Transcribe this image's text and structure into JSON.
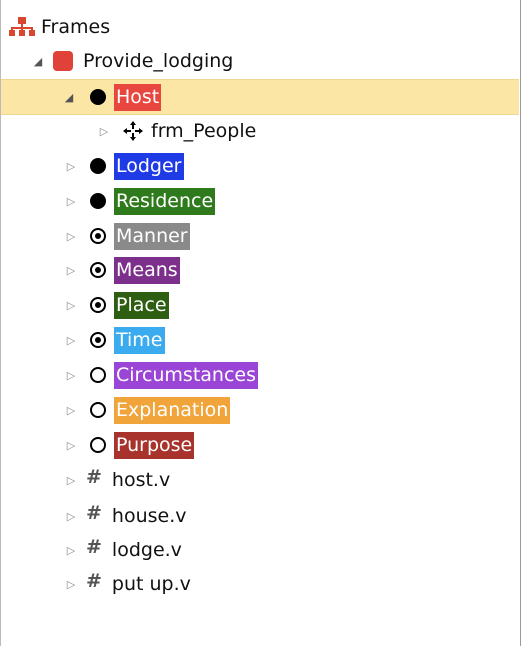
{
  "tree": {
    "root": {
      "label": "Frames",
      "icon": "hierarchy-icon"
    },
    "frame": {
      "label": "Provide_lodging",
      "icon": "frame-square-icon",
      "color": "#e0423a"
    },
    "elements": [
      {
        "label": "Host",
        "type": "core",
        "bg": "#e8473f",
        "fg": "#ffffff"
      },
      {
        "label": "Lodger",
        "type": "core",
        "bg": "#1f3be6",
        "fg": "#ffffff"
      },
      {
        "label": "Residence",
        "type": "core",
        "bg": "#2e7a1c",
        "fg": "#ffffff"
      },
      {
        "label": "Manner",
        "type": "peripheral",
        "bg": "#8a8a8a",
        "fg": "#ffffff"
      },
      {
        "label": "Means",
        "type": "peripheral",
        "bg": "#7d2f8c",
        "fg": "#ffffff"
      },
      {
        "label": "Place",
        "type": "peripheral",
        "bg": "#2d5e12",
        "fg": "#ffffff"
      },
      {
        "label": "Time",
        "type": "peripheral",
        "bg": "#3aabee",
        "fg": "#ffffff"
      },
      {
        "label": "Circumstances",
        "type": "extra",
        "bg": "#9a45d6",
        "fg": "#ffffff"
      },
      {
        "label": "Explanation",
        "type": "extra",
        "bg": "#f0a43a",
        "fg": "#ffffff"
      },
      {
        "label": "Purpose",
        "type": "extra",
        "bg": "#a8332c",
        "fg": "#ffffff"
      }
    ],
    "child_of_host": {
      "label": "frm_People",
      "icon": "move-cross-icon"
    },
    "lexical_units": [
      {
        "label": "host.v"
      },
      {
        "label": "house.v"
      },
      {
        "label": "lodge.v"
      },
      {
        "label": "put up.v"
      }
    ],
    "selected_color": "#fbe6a6"
  }
}
